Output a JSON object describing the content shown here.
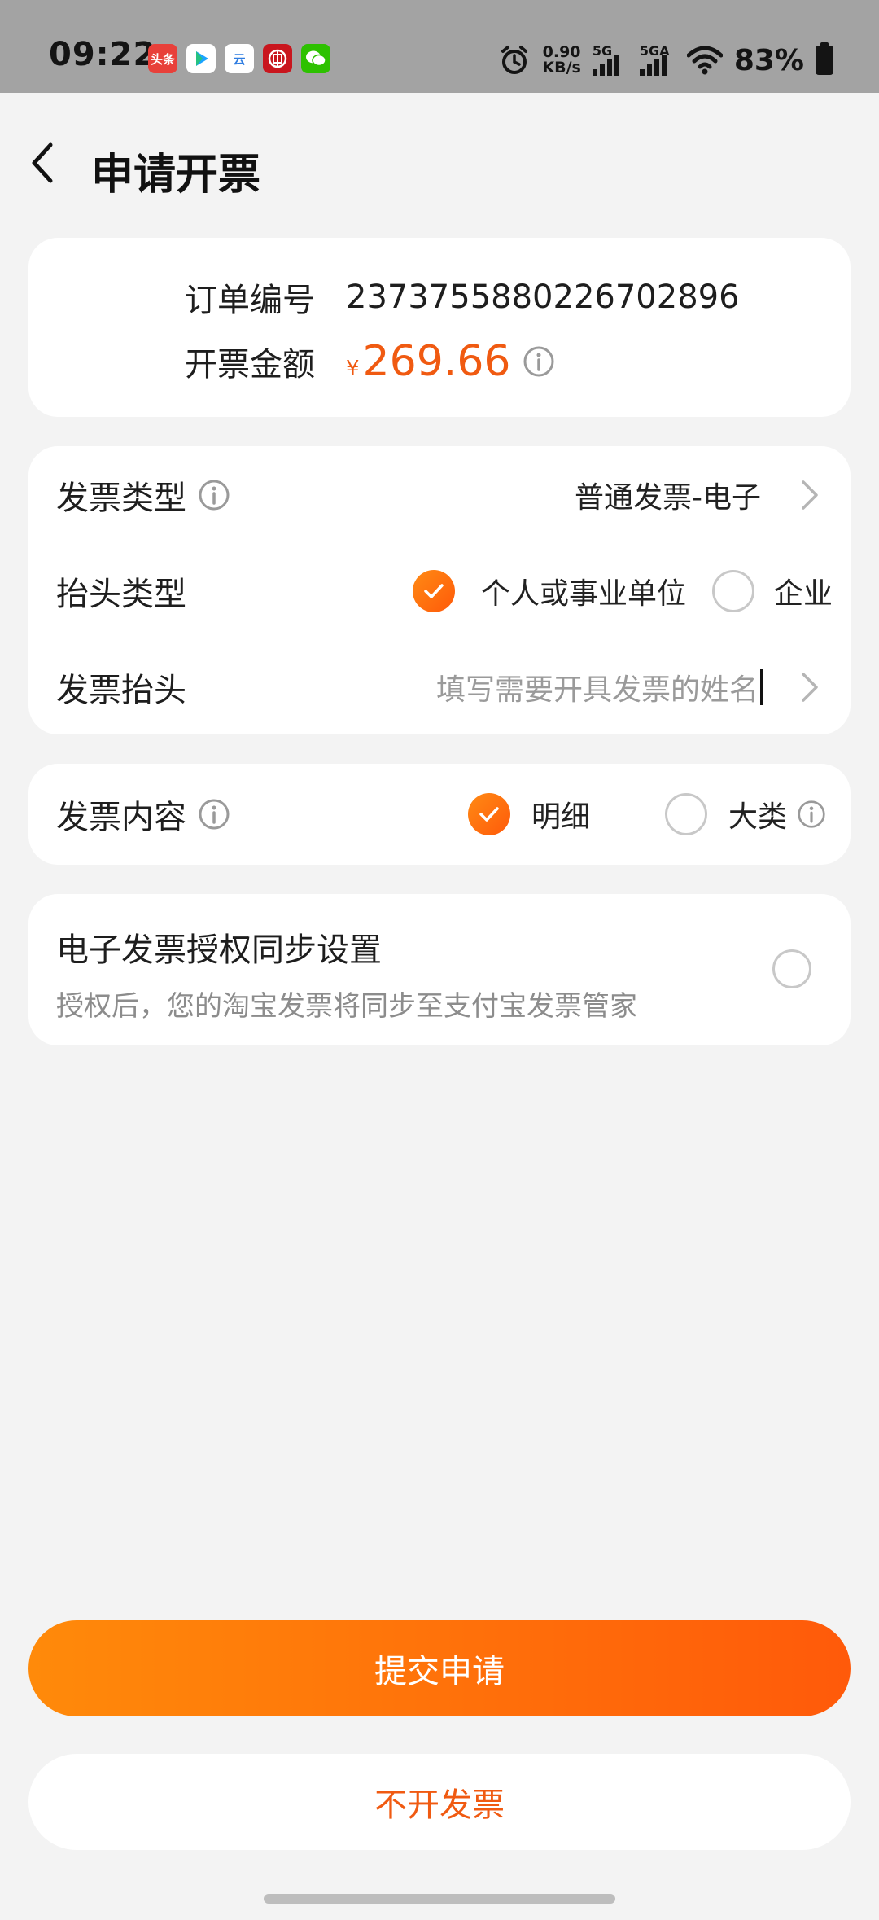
{
  "status_bar": {
    "time": "09:22",
    "apps": [
      {
        "icon": "toutiao-app-icon",
        "text": "头条",
        "color": "#e8403a"
      },
      {
        "icon": "video-play-app-icon",
        "text": "",
        "color": "#ffffff"
      },
      {
        "icon": "cloud-app-icon",
        "text": "云",
        "color": "#ffffff"
      },
      {
        "icon": "bank-app-icon",
        "text": "",
        "color": "#c9161e"
      },
      {
        "icon": "wechat-app-icon",
        "text": "",
        "color": "#2dc100"
      }
    ],
    "net_speed_value": "0.90",
    "net_speed_unit": "KB/s",
    "net1_label": "5G",
    "net2_label": "5GA",
    "battery_pct": "83%"
  },
  "header": {
    "title": "申请开票"
  },
  "order": {
    "number_label": "订单编号",
    "number_value": "2373755880226702896",
    "amount_label": "开票金额",
    "currency": "¥",
    "amount_value": "269.66"
  },
  "invoice": {
    "type_label": "发票类型",
    "type_value": "普通发票-电子",
    "title_type_label": "抬头类型",
    "title_type_options": [
      "个人或事业单位",
      "企业"
    ],
    "title_type_selected": "个人或事业单位",
    "title_label": "发票抬头",
    "title_placeholder": "填写需要开具发票的姓名"
  },
  "content": {
    "label": "发票内容",
    "options": [
      "明细",
      "大类"
    ],
    "selected": "明细"
  },
  "auth": {
    "title": "电子发票授权同步设置",
    "description": "授权后，您的淘宝发票将同步至支付宝发票管家"
  },
  "actions": {
    "submit_label": "提交申请",
    "no_invoice_label": "不开发票"
  },
  "colors": {
    "accent": "#f05a11",
    "gradient_start": "#ff8a0a",
    "gradient_end": "#ff5a0a",
    "background": "#f3f3f3"
  }
}
